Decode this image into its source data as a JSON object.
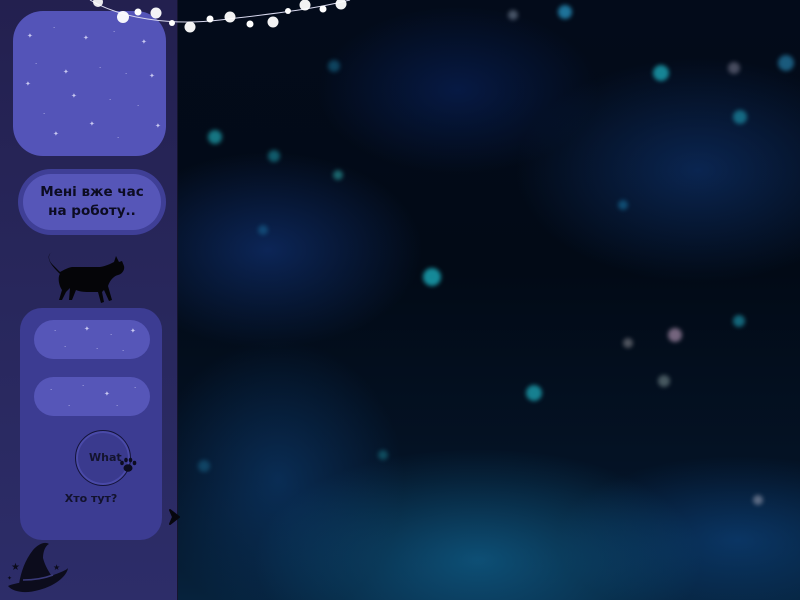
{
  "sidebar": {
    "speech_line1": "Мені вже час",
    "speech_line2": "на роботу..",
    "button_text": "What",
    "caption": "Хто тут?"
  },
  "icons": {
    "cat": "black-cat-icon",
    "paw": "paw-icon",
    "arrow": "arrow-right-icon",
    "hat": "witch-hat-icon",
    "lights": "string-lights-icon"
  },
  "colors": {
    "sidebar": "#28275c",
    "box": "#5454b8",
    "panel": "#3c3c92",
    "background": "#020811"
  }
}
